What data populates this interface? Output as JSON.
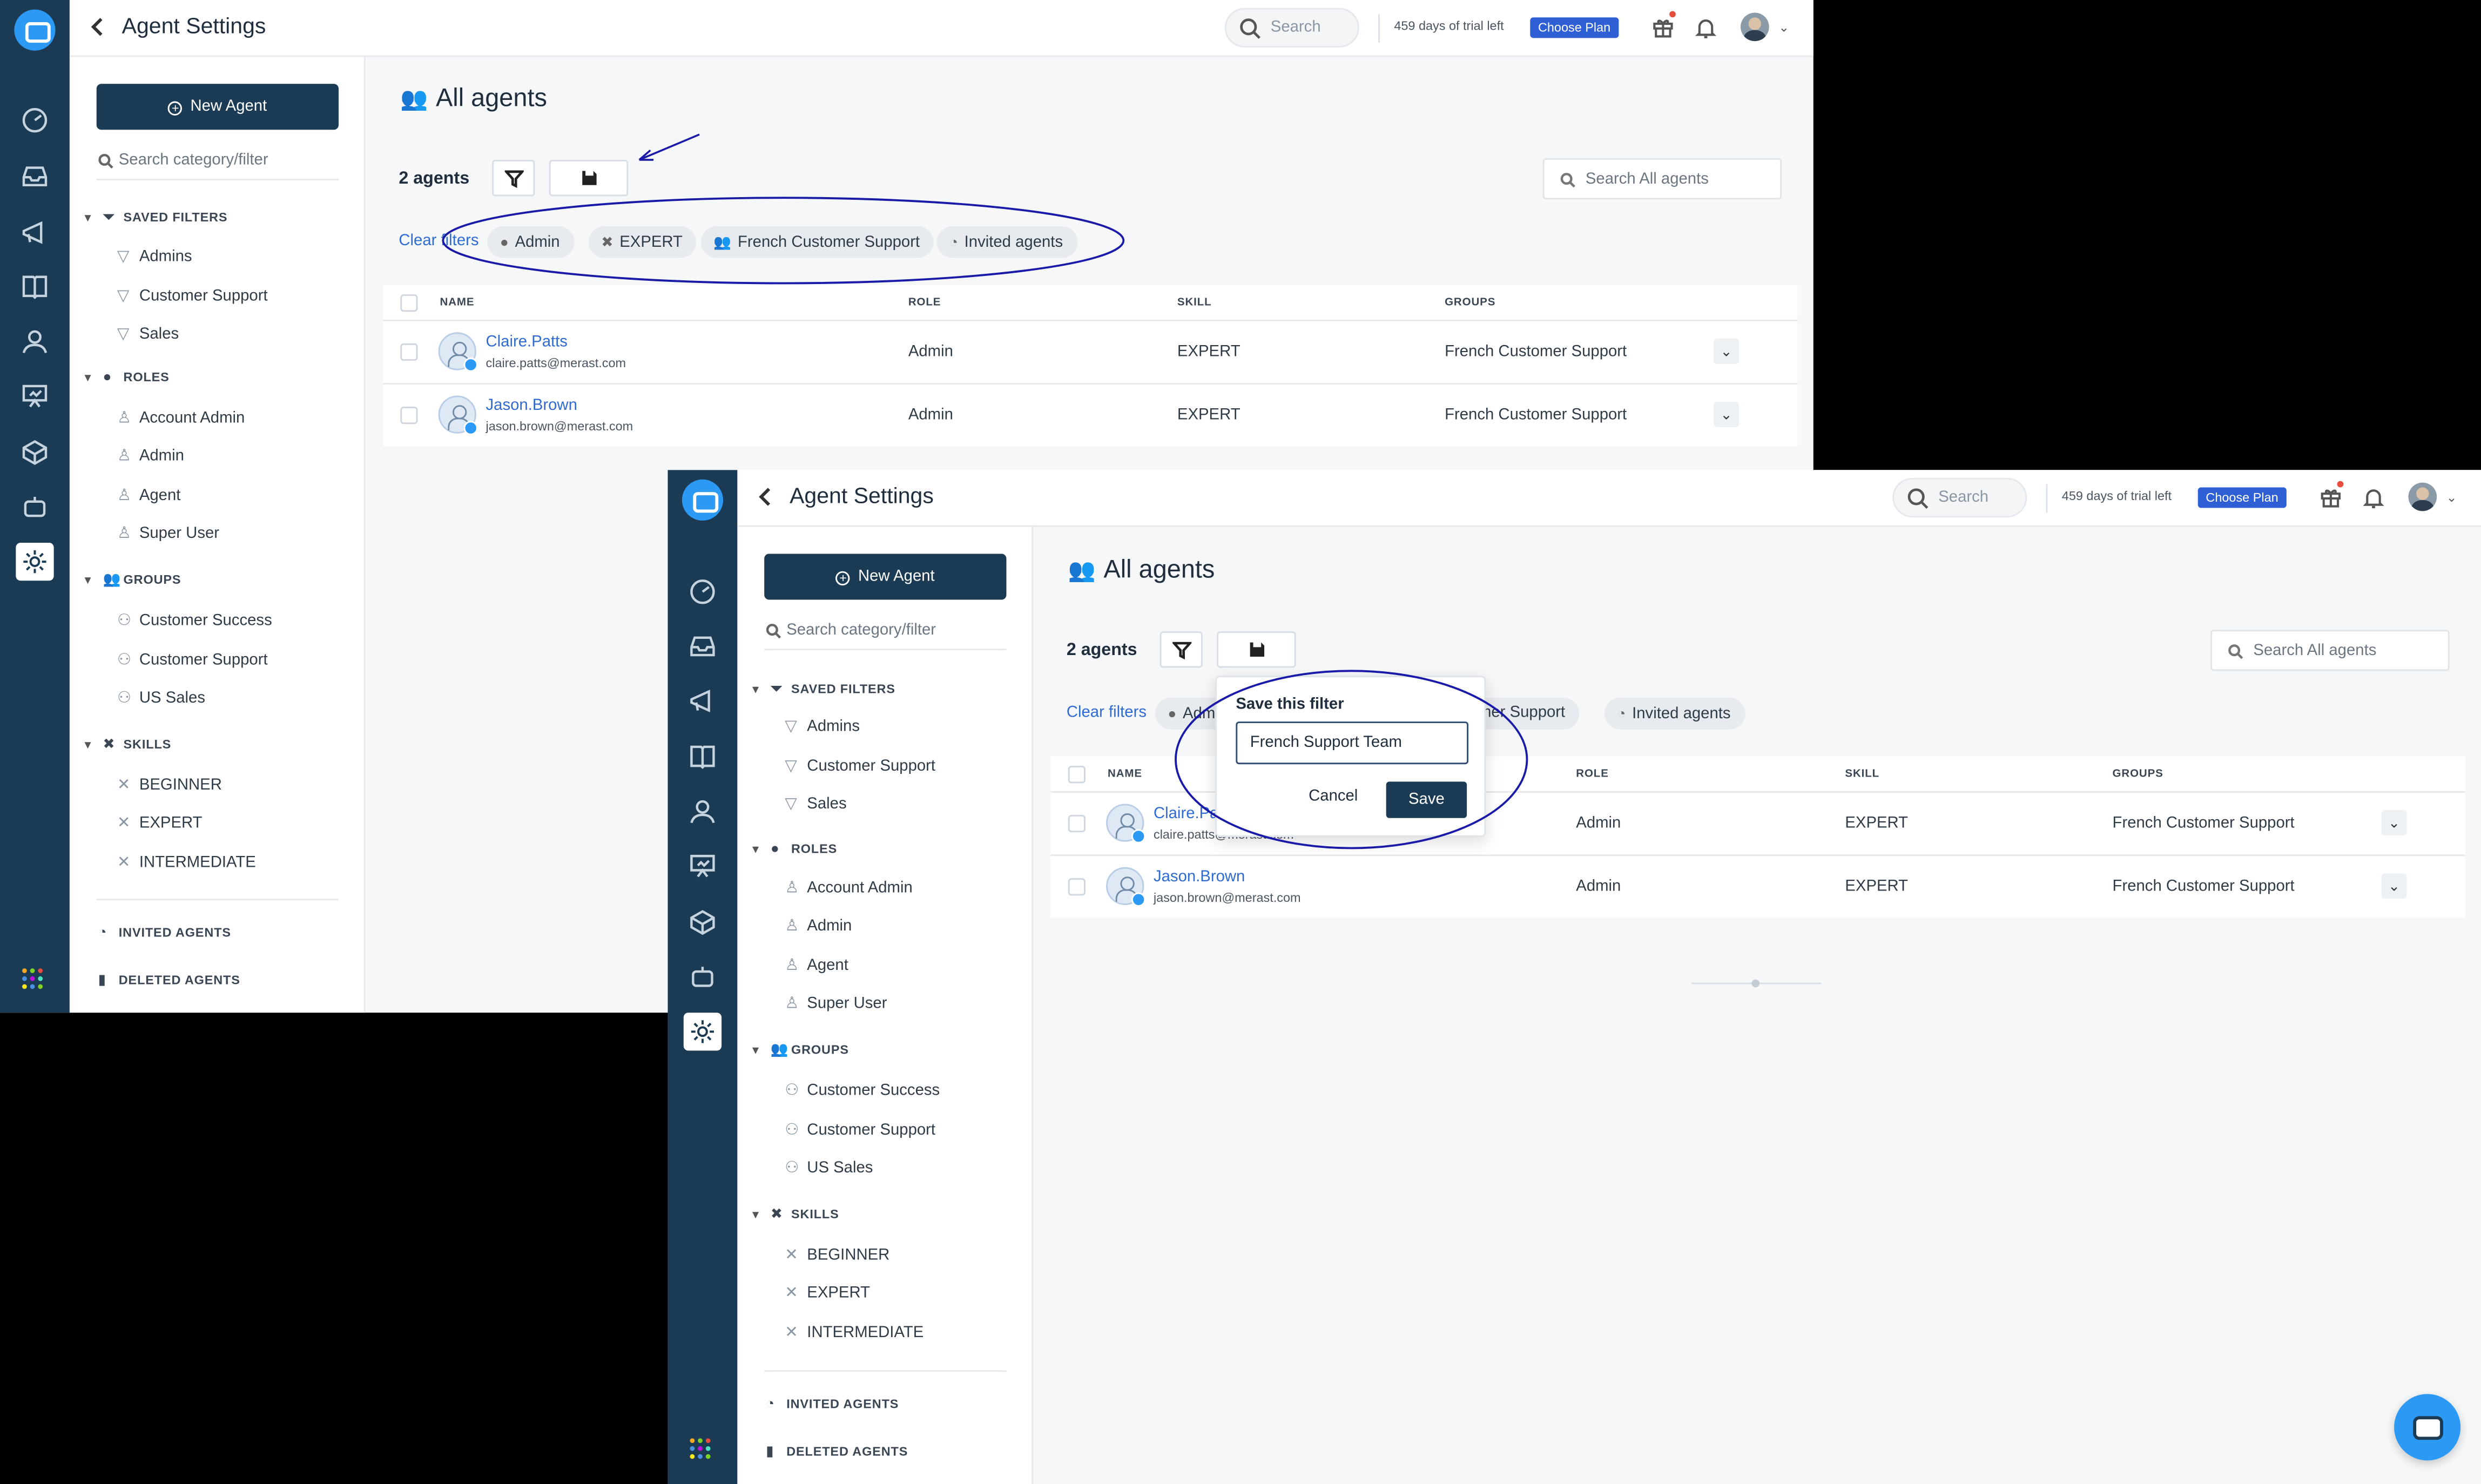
{
  "app": {
    "title": "Agent Settings",
    "top_search_placeholder": "Search",
    "trial_text": "459 days of trial left",
    "choose_plan": "Choose Plan"
  },
  "sidebar": {
    "new_agent": "New Agent",
    "category_search_placeholder": "Search category/filter",
    "sections": [
      {
        "label": "SAVED FILTERS",
        "items": [
          "Admins",
          "Customer Support",
          "Sales"
        ]
      },
      {
        "label": "ROLES",
        "items": [
          "Account Admin",
          "Admin",
          "Agent",
          "Super User"
        ]
      },
      {
        "label": "GROUPS",
        "items": [
          "Customer Success",
          "Customer Support",
          "US Sales"
        ]
      },
      {
        "label": "SKILLS",
        "items": [
          "BEGINNER",
          "EXPERT",
          "INTERMEDIATE"
        ]
      }
    ],
    "invited_agents": "INVITED AGENTS",
    "deleted_agents": "DELETED AGENTS"
  },
  "main": {
    "heading": "All agents",
    "count": "2 agents",
    "search_placeholder": "Search All agents",
    "clear_filters": "Clear filters",
    "chips": [
      "Admin",
      "EXPERT",
      "French Customer Support",
      "Invited agents"
    ],
    "columns": [
      "NAME",
      "ROLE",
      "SKILL",
      "GROUPS"
    ],
    "rows": [
      {
        "name": "Claire.Patts",
        "email": "claire.patts@merast.com",
        "role": "Admin",
        "skill": "EXPERT",
        "group": "French Customer Support"
      },
      {
        "name": "Jason.Brown",
        "email": "jason.brown@merast.com",
        "role": "Admin",
        "skill": "EXPERT",
        "group": "French Customer Support"
      }
    ]
  },
  "popover": {
    "title": "Save this filter",
    "input_value": "French Support Team",
    "cancel": "Cancel",
    "save": "Save"
  },
  "second_view": {
    "visible_chips": [
      "Admin",
      "Customer Support",
      "Invited agents"
    ]
  },
  "colors": {
    "rail": "#1b3a54",
    "accent_blue": "#2f6bd0",
    "choose_plan_bg": "#2f5fd4",
    "annotation": "#1a1aa8"
  }
}
